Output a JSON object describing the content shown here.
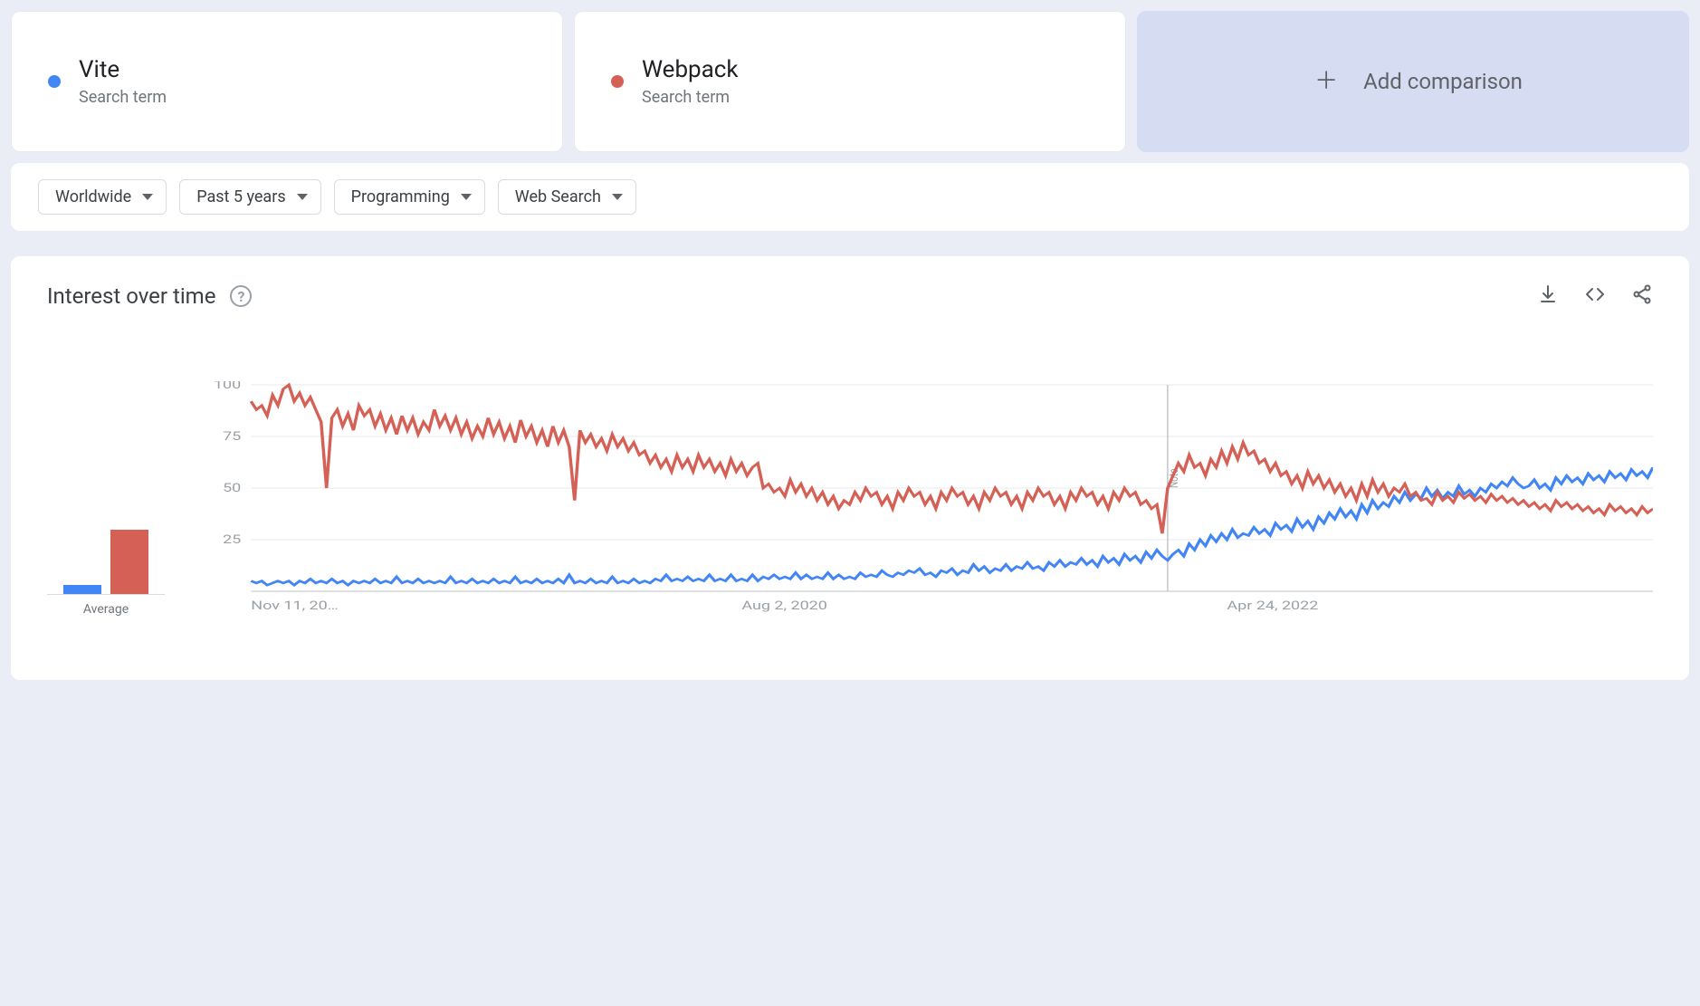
{
  "colors": {
    "vite": "#4285f4",
    "webpack": "#d56055"
  },
  "terms": [
    {
      "title": "Vite",
      "sub": "Search term",
      "colorKey": "vite"
    },
    {
      "title": "Webpack",
      "sub": "Search term",
      "colorKey": "webpack"
    }
  ],
  "addComparison": "Add comparison",
  "filters": [
    {
      "label": "Worldwide"
    },
    {
      "label": "Past 5 years"
    },
    {
      "label": "Programming"
    },
    {
      "label": "Web Search"
    }
  ],
  "panel": {
    "title": "Interest over time"
  },
  "average": {
    "label": "Average",
    "vite": 8,
    "webpack": 55
  },
  "chart_data": {
    "type": "line",
    "ylabel": "",
    "xlabel": "",
    "ylim": [
      0,
      100
    ],
    "yticks": [
      25,
      50,
      75,
      100
    ],
    "note_index": 170,
    "note_label": "Note",
    "xticks": [
      {
        "index": 0,
        "label": "Nov 11, 20…"
      },
      {
        "index": 91,
        "label": "Aug 2, 2020"
      },
      {
        "index": 181,
        "label": "Apr 24, 2022"
      }
    ],
    "series": [
      {
        "name": "Vite",
        "colorKey": "vite",
        "values": [
          5,
          4,
          5,
          3,
          4,
          5,
          4,
          5,
          3,
          5,
          4,
          6,
          4,
          5,
          4,
          6,
          4,
          5,
          3,
          5,
          4,
          5,
          4,
          6,
          4,
          5,
          4,
          7,
          4,
          5,
          4,
          6,
          4,
          5,
          4,
          5,
          4,
          7,
          4,
          5,
          4,
          6,
          4,
          5,
          4,
          6,
          4,
          5,
          4,
          7,
          4,
          5,
          4,
          6,
          4,
          5,
          4,
          6,
          4,
          8,
          4,
          5,
          4,
          6,
          4,
          5,
          4,
          7,
          4,
          5,
          4,
          6,
          4,
          5,
          4,
          6,
          5,
          8,
          5,
          6,
          5,
          7,
          5,
          6,
          5,
          8,
          5,
          6,
          5,
          8,
          5,
          6,
          5,
          8,
          5,
          7,
          6,
          8,
          6,
          7,
          6,
          9,
          6,
          8,
          6,
          7,
          6,
          9,
          6,
          8,
          6,
          7,
          6,
          9,
          7,
          8,
          7,
          10,
          8,
          7,
          9,
          8,
          10,
          9,
          11,
          8,
          9,
          7,
          10,
          9,
          11,
          8,
          10,
          9,
          13,
          10,
          12,
          9,
          11,
          10,
          13,
          10,
          12,
          11,
          14,
          11,
          12,
          10,
          14,
          12,
          15,
          12,
          14,
          13,
          16,
          13,
          15,
          12,
          17,
          14,
          16,
          13,
          18,
          15,
          17,
          14,
          19,
          16,
          20,
          17,
          15,
          18,
          20,
          17,
          23,
          20,
          25,
          22,
          27,
          24,
          28,
          25,
          30,
          26,
          28,
          27,
          31,
          28,
          30,
          27,
          33,
          30,
          32,
          29,
          35,
          31,
          34,
          30,
          36,
          33,
          38,
          35,
          40,
          36,
          39,
          35,
          42,
          38,
          44,
          40,
          43,
          41,
          46,
          43,
          48,
          44,
          47,
          45,
          50,
          46,
          49,
          45,
          48,
          46,
          51,
          47,
          49,
          46,
          50,
          48,
          52,
          50,
          53,
          51,
          55,
          52,
          50,
          51,
          54,
          50,
          52,
          49,
          55,
          52,
          56,
          53,
          55,
          52,
          57,
          54,
          56,
          53,
          58,
          55,
          57,
          54,
          59,
          56,
          58,
          55,
          60
        ]
      },
      {
        "name": "Webpack",
        "colorKey": "webpack",
        "values": [
          92,
          88,
          90,
          85,
          95,
          90,
          98,
          100,
          92,
          96,
          90,
          94,
          88,
          82,
          50,
          84,
          88,
          80,
          86,
          78,
          90,
          85,
          88,
          80,
          86,
          78,
          84,
          76,
          85,
          78,
          84,
          76,
          82,
          78,
          88,
          80,
          85,
          78,
          84,
          76,
          82,
          74,
          80,
          75,
          84,
          76,
          82,
          74,
          80,
          72,
          83,
          75,
          80,
          72,
          78,
          70,
          80,
          72,
          78,
          70,
          44,
          78,
          72,
          76,
          70,
          74,
          68,
          76,
          70,
          74,
          68,
          72,
          66,
          68,
          62,
          66,
          60,
          64,
          58,
          66,
          60,
          64,
          58,
          66,
          60,
          64,
          58,
          62,
          56,
          64,
          58,
          62,
          56,
          60,
          62,
          50,
          52,
          48,
          50,
          46,
          54,
          48,
          52,
          46,
          50,
          44,
          48,
          42,
          46,
          40,
          44,
          42,
          48,
          44,
          50,
          46,
          48,
          42,
          46,
          40,
          48,
          44,
          50,
          46,
          48,
          42,
          46,
          40,
          48,
          44,
          50,
          46,
          48,
          42,
          46,
          40,
          48,
          44,
          50,
          46,
          48,
          42,
          46,
          40,
          48,
          44,
          50,
          46,
          48,
          42,
          46,
          40,
          48,
          44,
          50,
          46,
          48,
          42,
          46,
          40,
          48,
          44,
          50,
          46,
          48,
          42,
          44,
          40,
          42,
          28,
          50,
          56,
          62,
          58,
          66,
          60,
          62,
          56,
          64,
          60,
          68,
          62,
          70,
          64,
          72,
          66,
          68,
          62,
          64,
          58,
          62,
          56,
          58,
          52,
          56,
          50,
          58,
          52,
          56,
          50,
          54,
          48,
          52,
          46,
          50,
          44,
          52,
          46,
          54,
          48,
          52,
          46,
          50,
          48,
          52,
          46,
          48,
          44,
          45,
          42,
          48,
          44,
          46,
          43,
          48,
          45,
          47,
          44,
          46,
          43,
          47,
          44,
          46,
          43,
          45,
          42,
          44,
          41,
          43,
          40,
          42,
          39,
          44,
          41,
          43,
          40,
          42,
          39,
          41,
          38,
          40,
          37,
          42,
          39,
          41,
          38,
          40,
          37,
          41,
          38,
          40
        ]
      }
    ]
  }
}
